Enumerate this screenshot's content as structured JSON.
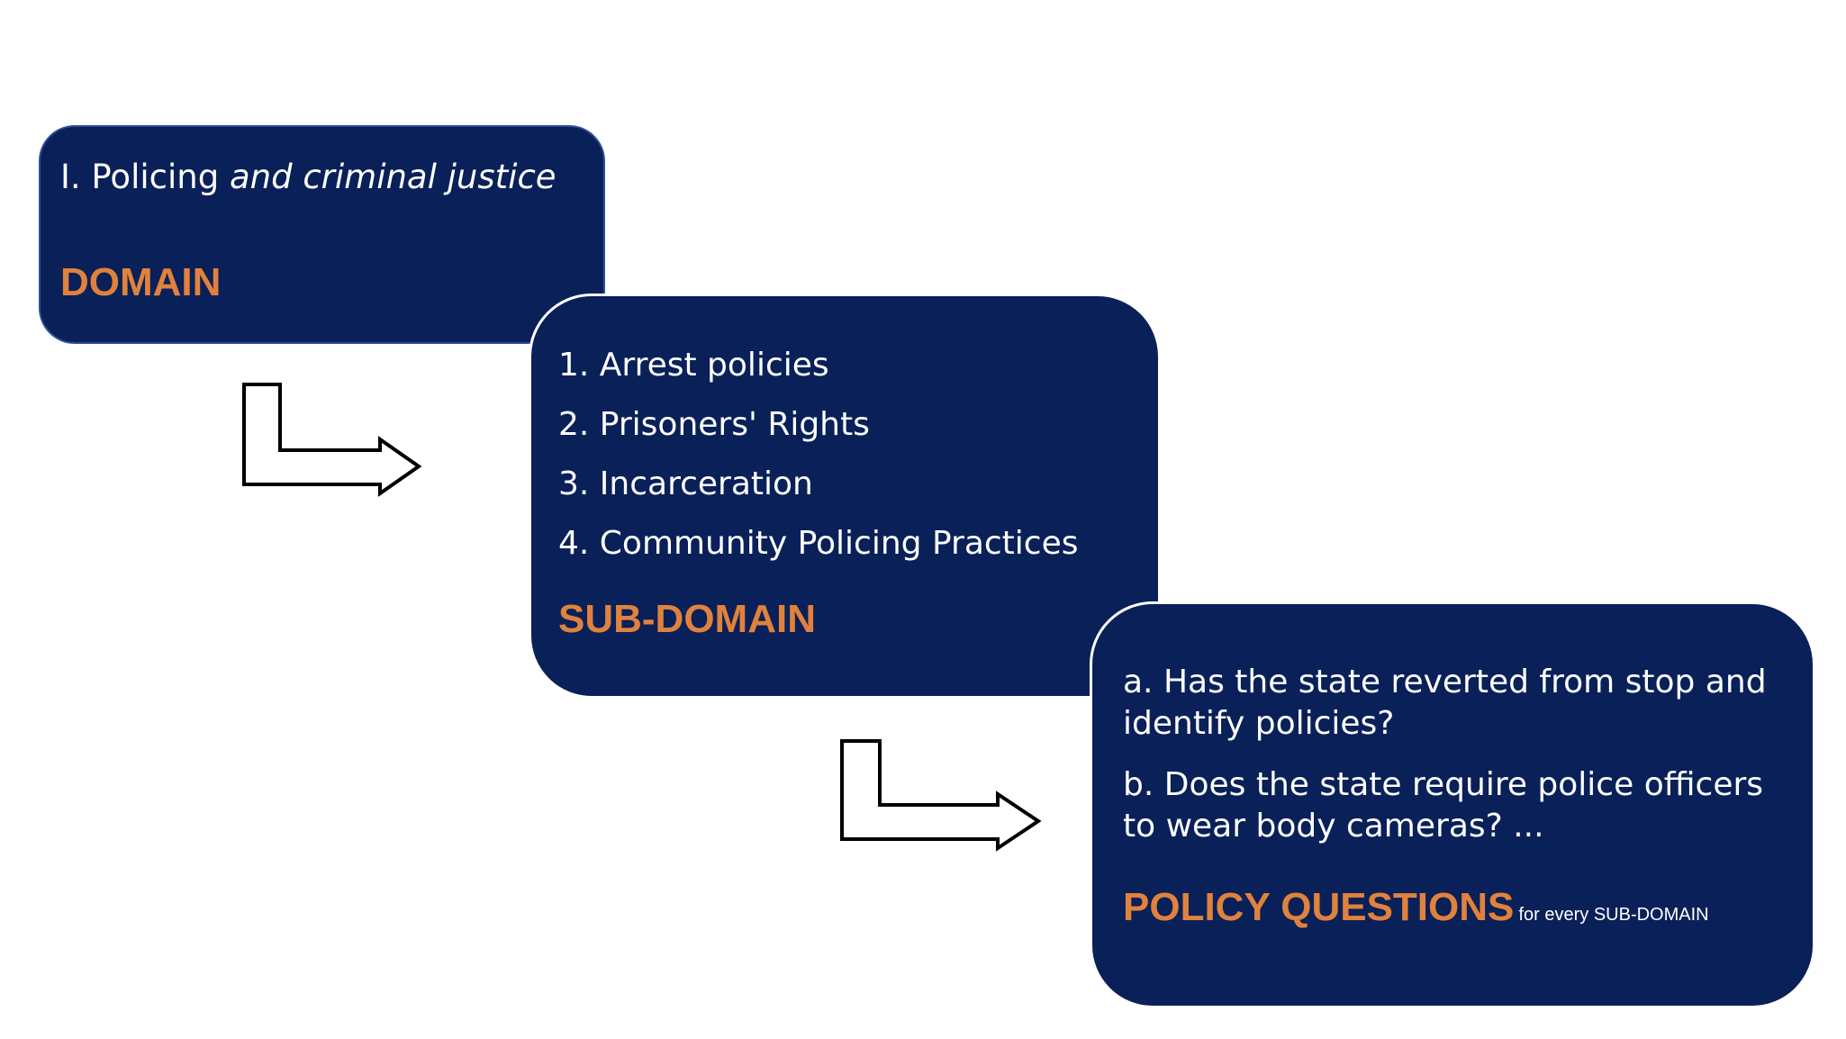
{
  "domain": {
    "title_plain": "I. Policing",
    "title_italic": "and criminal justice",
    "tag": "DOMAIN"
  },
  "subdomain": {
    "items": [
      "1. Arrest policies",
      "2. Prisoners' Rights",
      "3. Incarceration",
      "4. Community Policing Practices"
    ],
    "tag": "SUB-DOMAIN"
  },
  "policy": {
    "questions": [
      "a. Has the state reverted from stop and identify policies?",
      "b. Does the state require police officers to wear body cameras? ..."
    ],
    "tag": "POLICY QUESTIONS",
    "note": "for every SUB-DOMAIN"
  },
  "colors": {
    "box_fill": "#0a2059",
    "accent": "#e0823d",
    "text": "#ffffff"
  }
}
